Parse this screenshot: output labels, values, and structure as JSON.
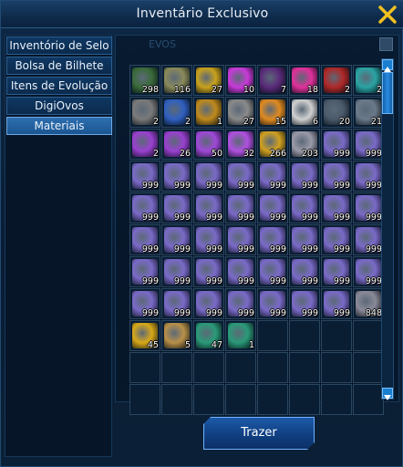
{
  "window": {
    "title": "Inventário Exclusivo"
  },
  "sidebar": {
    "tabs": [
      {
        "label": "Inventório de Selo"
      },
      {
        "label": "Bolsa de Bilhete"
      },
      {
        "label": "Itens de Evolução"
      },
      {
        "label": "DigiOvos"
      },
      {
        "label": "Materiais"
      }
    ],
    "active_tab": 4
  },
  "background_label": "EVOS",
  "grid": {
    "columns": 8,
    "rows": 11,
    "items": [
      {
        "icon": "green-chest-icon",
        "qty": "298",
        "color": "#3a6b3a"
      },
      {
        "icon": "star-badge-icon",
        "qty": "116",
        "color": "#8a8a5a"
      },
      {
        "icon": "gold-star-icon",
        "qty": "27",
        "color": "#c9a21c"
      },
      {
        "icon": "pink-spark-icon",
        "qty": "10",
        "color": "#c83ad8"
      },
      {
        "icon": "dark-crystal-icon",
        "qty": "7",
        "color": "#5a2a7a"
      },
      {
        "icon": "pink-orb-icon",
        "qty": "18",
        "color": "#e0309a"
      },
      {
        "icon": "red-gem-icon",
        "qty": "2",
        "color": "#b02828"
      },
      {
        "icon": "teal-gem-icon",
        "qty": "2",
        "color": "#2aa4a4"
      },
      {
        "icon": "silver-ring-icon",
        "qty": "2",
        "color": "#7a7a7a"
      },
      {
        "icon": "lightning-icon",
        "qty": "2",
        "color": "#3060c0"
      },
      {
        "icon": "gold-chest-icon",
        "qty": "1",
        "color": "#c08a1c"
      },
      {
        "icon": "silver-orb-icon",
        "qty": "27",
        "color": "#8a8a8a"
      },
      {
        "icon": "burst-icon",
        "qty": "15",
        "color": "#e08a20"
      },
      {
        "icon": "white-orb-icon",
        "qty": "6",
        "color": "#d0d0d0"
      },
      {
        "icon": "disk-icon",
        "qty": "20",
        "color": "#4a5a6a"
      },
      {
        "icon": "crystal-shard-icon",
        "qty": "21",
        "color": "#6a7a8a"
      },
      {
        "icon": "purple-atom-icon",
        "qty": "2",
        "color": "#9a40d0"
      },
      {
        "icon": "purple-atom-icon",
        "qty": "26",
        "color": "#9a40d0"
      },
      {
        "icon": "purple-atom-icon",
        "qty": "50",
        "color": "#a048d8"
      },
      {
        "icon": "purple-atom-icon",
        "qty": "32",
        "color": "#b050e0"
      },
      {
        "icon": "gold-coin-icon",
        "qty": "266",
        "color": "#d0a020"
      },
      {
        "icon": "silver-atom-icon",
        "qty": "203",
        "color": "#9a9aa8"
      },
      {
        "icon": "pink-blue-orb-icon",
        "qty": "999",
        "color": "#7a6ac8"
      },
      {
        "icon": "pink-blue-orb-icon",
        "qty": "999",
        "color": "#7a6ac8"
      },
      {
        "icon": "pink-blue-orb-icon",
        "qty": "999",
        "color": "#7a6ac8"
      },
      {
        "icon": "pink-blue-orb-icon",
        "qty": "999",
        "color": "#7a6ac8"
      },
      {
        "icon": "pink-blue-orb-icon",
        "qty": "999",
        "color": "#7a6ac8"
      },
      {
        "icon": "pink-blue-orb-icon",
        "qty": "999",
        "color": "#7a6ac8"
      },
      {
        "icon": "pink-blue-orb-icon",
        "qty": "999",
        "color": "#7a6ac8"
      },
      {
        "icon": "pink-blue-orb-icon",
        "qty": "999",
        "color": "#7a6ac8"
      },
      {
        "icon": "pink-blue-orb-icon",
        "qty": "999",
        "color": "#7a6ac8"
      },
      {
        "icon": "pink-blue-orb-icon",
        "qty": "999",
        "color": "#7a6ac8"
      },
      {
        "icon": "pink-blue-orb-icon",
        "qty": "999",
        "color": "#7a6ac8"
      },
      {
        "icon": "pink-blue-orb-icon",
        "qty": "999",
        "color": "#7a6ac8"
      },
      {
        "icon": "pink-blue-orb-icon",
        "qty": "999",
        "color": "#7a6ac8"
      },
      {
        "icon": "pink-blue-orb-icon",
        "qty": "999",
        "color": "#7a6ac8"
      },
      {
        "icon": "pink-blue-orb-icon",
        "qty": "999",
        "color": "#7a6ac8"
      },
      {
        "icon": "pink-blue-orb-icon",
        "qty": "999",
        "color": "#7a6ac8"
      },
      {
        "icon": "pink-blue-orb-icon",
        "qty": "999",
        "color": "#7a6ac8"
      },
      {
        "icon": "pink-blue-orb-icon",
        "qty": "999",
        "color": "#7a6ac8"
      },
      {
        "icon": "pink-blue-orb-icon",
        "qty": "999",
        "color": "#7a6ac8"
      },
      {
        "icon": "pink-blue-orb-icon",
        "qty": "999",
        "color": "#7a6ac8"
      },
      {
        "icon": "pink-blue-orb-icon",
        "qty": "999",
        "color": "#7a6ac8"
      },
      {
        "icon": "pink-blue-orb-icon",
        "qty": "999",
        "color": "#7a6ac8"
      },
      {
        "icon": "pink-blue-orb-icon",
        "qty": "999",
        "color": "#7a6ac8"
      },
      {
        "icon": "pink-blue-orb-icon",
        "qty": "999",
        "color": "#7a6ac8"
      },
      {
        "icon": "pink-blue-orb-icon",
        "qty": "999",
        "color": "#7a6ac8"
      },
      {
        "icon": "pink-blue-orb-icon",
        "qty": "999",
        "color": "#7a6ac8"
      },
      {
        "icon": "pink-blue-orb-icon",
        "qty": "999",
        "color": "#7a6ac8"
      },
      {
        "icon": "pink-blue-orb-icon",
        "qty": "999",
        "color": "#7a6ac8"
      },
      {
        "icon": "pink-blue-orb-icon",
        "qty": "999",
        "color": "#7a6ac8"
      },
      {
        "icon": "pink-blue-orb-icon",
        "qty": "999",
        "color": "#7a6ac8"
      },
      {
        "icon": "pink-blue-orb-icon",
        "qty": "999",
        "color": "#7a6ac8"
      },
      {
        "icon": "pink-blue-orb-icon",
        "qty": "999",
        "color": "#7a6ac8"
      },
      {
        "icon": "pink-blue-orb-icon",
        "qty": "999",
        "color": "#7a6ac8"
      },
      {
        "icon": "pink-blue-orb-icon",
        "qty": "999",
        "color": "#7a6ac8"
      },
      {
        "icon": "pink-blue-orb-icon",
        "qty": "999",
        "color": "#7a6ac8"
      },
      {
        "icon": "pink-blue-orb-icon",
        "qty": "999",
        "color": "#7a6ac8"
      },
      {
        "icon": "pink-blue-orb-icon",
        "qty": "999",
        "color": "#7a6ac8"
      },
      {
        "icon": "pink-blue-orb-icon",
        "qty": "999",
        "color": "#7a6ac8"
      },
      {
        "icon": "pink-blue-orb-icon",
        "qty": "999",
        "color": "#7a6ac8"
      },
      {
        "icon": "pink-blue-orb-icon",
        "qty": "999",
        "color": "#7a6ac8"
      },
      {
        "icon": "pink-blue-orb-icon",
        "qty": "999",
        "color": "#7a6ac8"
      },
      {
        "icon": "silver-star-icon",
        "qty": "848",
        "color": "#8a8a98"
      },
      {
        "icon": "gold-medal-icon",
        "qty": "45",
        "color": "#d8a818"
      },
      {
        "icon": "scroll-icon",
        "qty": "5",
        "color": "#b89048"
      },
      {
        "icon": "teal-card-icon",
        "qty": "47",
        "color": "#2a9a78"
      },
      {
        "icon": "teal-card-icon",
        "qty": "1",
        "color": "#2a9a78"
      }
    ]
  },
  "scrollbar": {
    "position": 0.0
  },
  "footer": {
    "bring_label": "Trazer"
  },
  "colors": {
    "accent": "#1a7fd0",
    "active_tab": "#2e6fb0",
    "close": "#f0c020"
  }
}
